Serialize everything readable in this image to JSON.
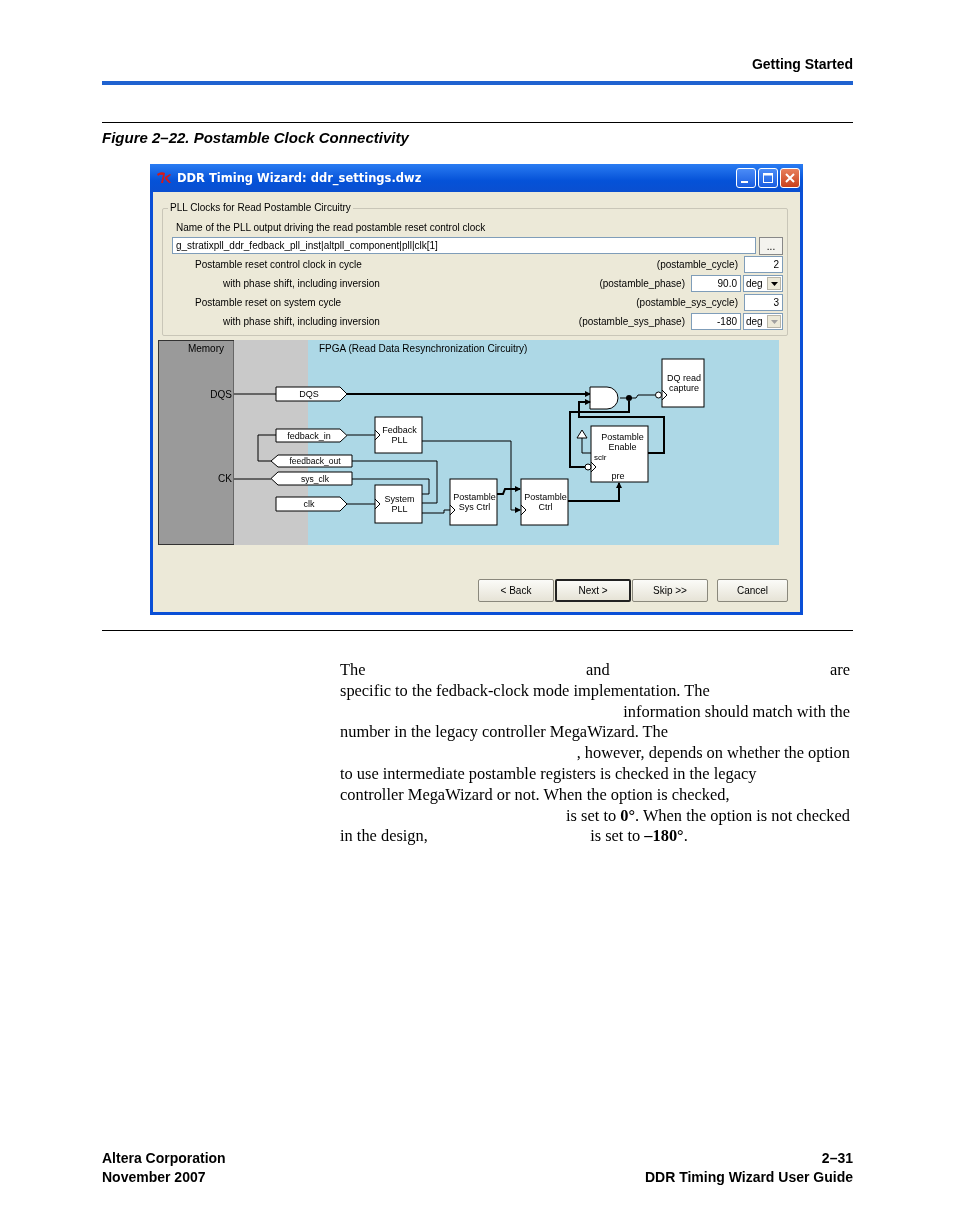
{
  "header": {
    "section": "Getting Started"
  },
  "figure": {
    "caption": "Figure 2–22. Postamble Clock Connectivity"
  },
  "window": {
    "title": "DDR Timing Wizard: ddr_settings.dwz",
    "group": {
      "legend": "PLL Clocks for Read Postamble Circuitry",
      "field_label": "Name of the PLL output driving the read postamble reset control clock",
      "field_value": "g_stratixpll_ddr_fedback_pll_inst|altpll_component|pll|clk[1]",
      "browse": "...",
      "rows": [
        {
          "kind": "cycle",
          "label": "Postamble reset control clock in cycle",
          "param": "(postamble_cycle)",
          "value": "2"
        },
        {
          "kind": "phase",
          "label": "with phase shift, including inversion",
          "param": "(postamble_phase)",
          "value": "90.0",
          "unit": "deg",
          "disabled": false
        },
        {
          "kind": "cycle",
          "label": "Postamble reset on system cycle",
          "param": "(postamble_sys_cycle)",
          "value": "3"
        },
        {
          "kind": "phase",
          "label": "with phase shift, including inversion",
          "param": "(postamble_sys_phase)",
          "value": "-180",
          "unit": "deg",
          "disabled": true
        }
      ]
    },
    "diagram": {
      "memory_label": "Memory",
      "fpga_label": "FPGA (Read Data Resynchronization Circuitry)",
      "ports": [
        "DQS",
        "CK"
      ],
      "pins": [
        {
          "label": "DQS",
          "kind": "input"
        },
        {
          "label": "fedback_in",
          "kind": "input"
        },
        {
          "label": "feedback_out",
          "kind": "output"
        },
        {
          "label": "sys_clk",
          "kind": "output"
        },
        {
          "label": "clk",
          "kind": "input"
        }
      ],
      "blocks": [
        {
          "lines": [
            "Fedback",
            "PLL"
          ]
        },
        {
          "lines": [
            "System",
            "PLL"
          ]
        },
        {
          "lines": [
            "Postamble",
            "Sys Ctrl"
          ]
        },
        {
          "lines": [
            "Postamble",
            "Ctrl"
          ]
        },
        {
          "lines": [
            "Postamble",
            "Enable"
          ]
        },
        {
          "lines": [
            "DQ read",
            "capture"
          ]
        }
      ],
      "enable_pins": [
        "sclr",
        "pre"
      ]
    },
    "buttons": [
      {
        "label": "< Back",
        "default": false
      },
      {
        "label": "Next >",
        "default": true
      },
      {
        "label": "Skip >>",
        "default": false
      },
      {
        "label": "Cancel",
        "default": false
      }
    ]
  },
  "body": {
    "lines": [
      [
        {
          "kind": "text",
          "text": "The"
        },
        {
          "kind": "gap"
        },
        {
          "kind": "text",
          "text": "and"
        },
        {
          "kind": "gap"
        },
        {
          "kind": "text",
          "text": "are"
        }
      ],
      [
        {
          "kind": "text",
          "text": "specific to the fedback-clock mode implementation. The"
        }
      ],
      [
        {
          "kind": "gap"
        },
        {
          "kind": "text",
          "text": "information should match with the"
        }
      ],
      [
        {
          "kind": "text",
          "text": "number in the legacy controller MegaWizard. The"
        }
      ],
      [
        {
          "kind": "gap"
        },
        {
          "kind": "text",
          "text": ", however, depends on whether the option"
        }
      ],
      [
        {
          "kind": "text",
          "text": "to use intermediate postamble registers is checked in the legacy"
        }
      ],
      [
        {
          "kind": "text",
          "text": "controller MegaWizard or not. When the option is checked,"
        }
      ],
      [
        {
          "kind": "gap"
        },
        {
          "kind": "text",
          "text": "is set to **0°**. When the option is not checked"
        }
      ],
      [
        {
          "kind": "text",
          "text": "in the design,"
        },
        {
          "kind": "gap"
        },
        {
          "kind": "text",
          "text": "is set to **–180°**."
        },
        {
          "kind": "gap"
        }
      ]
    ]
  },
  "footer": {
    "left": [
      "Altera Corporation",
      "November 2007"
    ],
    "right": [
      "2–31",
      "DDR Timing Wizard User Guide"
    ]
  }
}
